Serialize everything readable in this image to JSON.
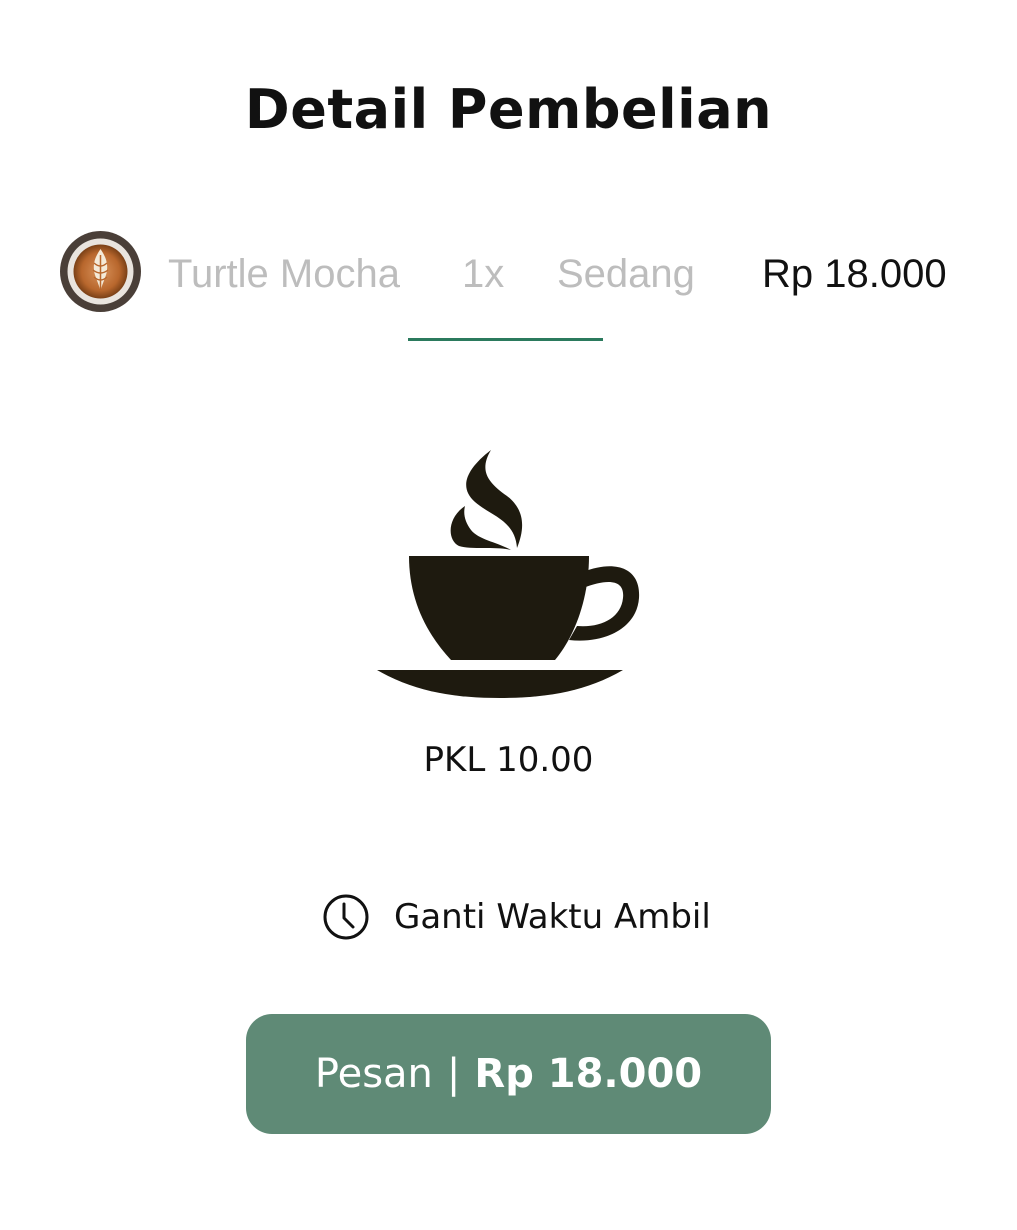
{
  "header": {
    "title": "Detail Pembelian"
  },
  "item": {
    "image": "latte-art-thumbnail",
    "name": "Turtle Mocha",
    "quantity": "1x",
    "size": "Sedang",
    "price": "Rp 18.000"
  },
  "illustration": {
    "icon": "coffee-cup-icon"
  },
  "pickup": {
    "time": "PKL 10.00",
    "change_label": "Ganti Waktu Ambil",
    "icon": "clock-icon"
  },
  "order_button": {
    "label": "Pesan",
    "separator": "|",
    "price": "Rp 18.000",
    "color": "#5f8a76"
  },
  "colors": {
    "accent_underline": "#2b7a5d",
    "muted_text": "#bdbdbd",
    "cup": "#1e1a0f"
  }
}
